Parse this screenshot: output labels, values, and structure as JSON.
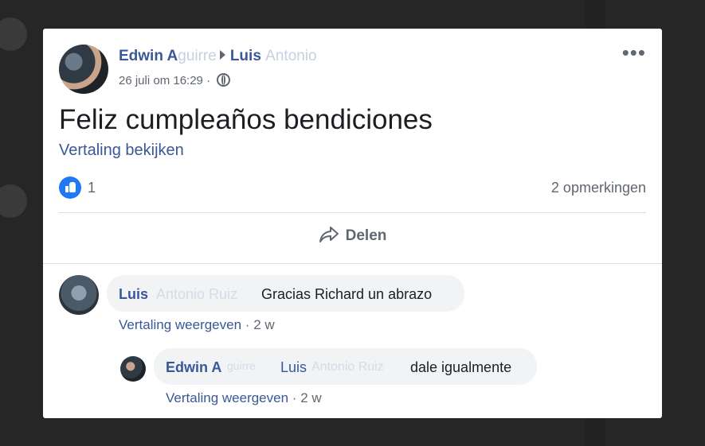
{
  "post": {
    "author_first": "Edwin A",
    "author_hidden": "guirre",
    "recipient": "Luis",
    "recipient_hidden": "Antonio",
    "date": "26 juli om 16:29",
    "dot": "·",
    "text": "Feliz cumpleaños bendiciones",
    "translate_label": "Vertaling bekijken",
    "like_count": "1",
    "comment_count": "2 opmerkingen",
    "share_label": "Delen",
    "more_label": "•••"
  },
  "comments": [
    {
      "name": "Luis",
      "name_hidden": "Antonio Ruiz",
      "text": "Gracias Richard un abrazo",
      "translate_label": "Vertaling weergeven",
      "dot": "·",
      "time": "2 w"
    },
    {
      "name": "Edwin A",
      "name_hidden": "guirre",
      "mention": "Luis",
      "mention_hidden": "Antonio Ruiz",
      "text": "dale igualmente",
      "translate_label": "Vertaling weergeven",
      "dot": "·",
      "time": "2 w"
    }
  ],
  "colors": {
    "link": "#385898",
    "like": "#2078f4",
    "muted": "#606770",
    "bubble": "#f2f3f5"
  },
  "icons": [
    "globe-icon",
    "like-icon",
    "share-icon",
    "more-options-icon"
  ]
}
